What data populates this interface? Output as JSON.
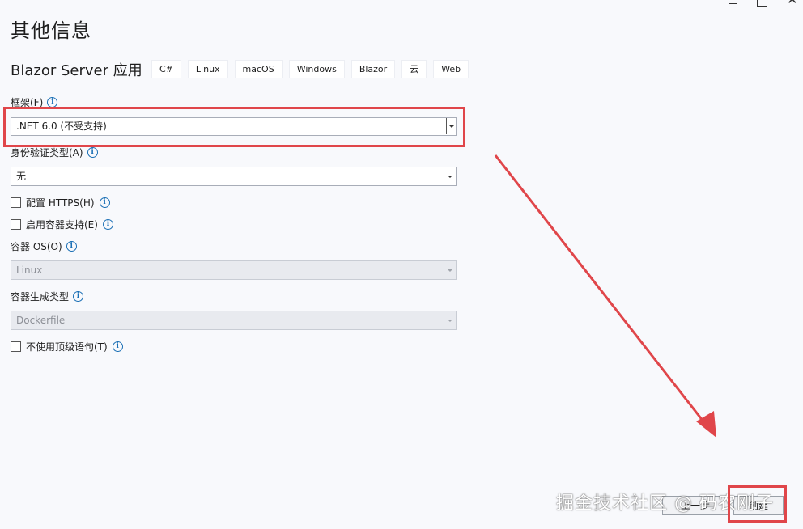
{
  "window": {
    "minimize_glyph": "",
    "maximize_glyph": "",
    "close_glyph": "✕"
  },
  "page_title": "其他信息",
  "project": {
    "name": "Blazor Server 应用",
    "tags": [
      "C#",
      "Linux",
      "macOS",
      "Windows",
      "Blazor",
      "云",
      "Web"
    ]
  },
  "framework": {
    "label": "框架(F)",
    "value": ".NET 6.0 (不受支持)"
  },
  "auth": {
    "label": "身份验证类型(A)",
    "value": "无"
  },
  "options": {
    "https_label": "配置 HTTPS(H)",
    "container_label": "启用容器支持(E)"
  },
  "container_os": {
    "label": "容器 OS(O)",
    "value": "Linux"
  },
  "container_build": {
    "label": "容器生成类型",
    "value": "Dockerfile"
  },
  "top_level": {
    "label": "不使用顶级语句(T)"
  },
  "footer": {
    "back_label": "上一步",
    "next_label": "创建"
  },
  "info_glyph": "i",
  "watermark": "掘金技术社区 @ 码农刚子",
  "annotation_color": "#e0464a"
}
